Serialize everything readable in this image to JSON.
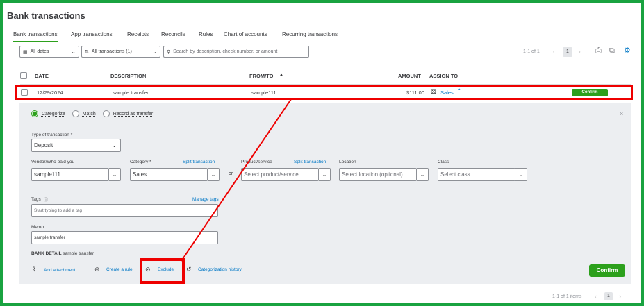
{
  "page": {
    "title": "Bank transactions"
  },
  "tabs": [
    {
      "label": "Bank transactions",
      "active": true
    },
    {
      "label": "App transactions"
    },
    {
      "label": "Receipts"
    },
    {
      "label": "Reconcile"
    },
    {
      "label": "Rules"
    },
    {
      "label": "Chart of accounts"
    },
    {
      "label": "Recurring transactions"
    }
  ],
  "filters": {
    "dates": "All dates",
    "transactions": "All transactions (1)",
    "search_placeholder": "Search by description, check number, or amount"
  },
  "pager": {
    "range": "1-1 of 1",
    "page": "1"
  },
  "table": {
    "headers": {
      "date": "DATE",
      "description": "DESCRIPTION",
      "from_to": "FROM/TO",
      "sort_arrow": "▲",
      "amount": "AMOUNT",
      "assign_to": "ASSIGN TO"
    },
    "row": {
      "date": "12/29/2024",
      "description": "sample transfer",
      "from_to": "sample111",
      "amount": "$111.00",
      "assign_to": "Sales",
      "confirm": "Confirm"
    }
  },
  "detail": {
    "modes": [
      "Categorize",
      "Match",
      "Record as transfer"
    ],
    "close": "×",
    "type_label": "Type of transaction *",
    "type_value": "Deposit",
    "vendor_label": "Vendor/Who paid you",
    "vendor_value": "sample111",
    "category_label": "Category *",
    "category_split": "Split transaction",
    "category_value": "Sales",
    "or": "or",
    "product_label": "Product/service",
    "product_split": "Split transaction",
    "product_placeholder": "Select product/service",
    "location_label": "Location",
    "location_placeholder": "Select location (optional)",
    "class_label": "Class",
    "class_placeholder": "Select class",
    "tags_label": "Tags",
    "manage_tags": "Manage tags",
    "tags_placeholder": "Start typing to add a tag",
    "memo_label": "Memo",
    "memo_value": "sample transfer",
    "bank_detail_label": "BANK DETAIL",
    "bank_detail_value": "sample transfer",
    "add_attachment": "Add attachment",
    "create_rule": "Create a rule",
    "exclude": "Exclude",
    "categorization_history": "Categorization history",
    "confirm": "Confirm"
  },
  "footer_pager": {
    "range": "1-1 of 1 items",
    "page": "1"
  },
  "colors": {
    "accent": "#2ca01c",
    "link": "#0077c5",
    "highlight": "#ee0000",
    "border": "#19a340"
  }
}
